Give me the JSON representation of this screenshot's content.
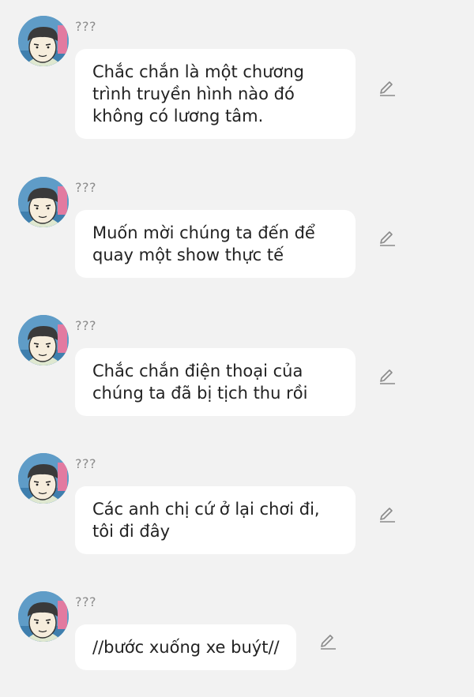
{
  "colors": {
    "background": "#f2f2f2",
    "bubble": "#ffffff",
    "name_text": "#8b8b8b",
    "message_text": "#222222",
    "icon": "#8a8a8a"
  },
  "messages": [
    {
      "sender": "???",
      "text": "Chắc chắn là một chương trình truyền hình nào đó không có lương tâm.",
      "icon": "pencil-edit-icon"
    },
    {
      "sender": "???",
      "text": "Muốn mời chúng ta đến để quay một show thực tế",
      "icon": "pencil-edit-icon"
    },
    {
      "sender": "???",
      "text": "Chắc chắn điện thoại của chúng ta đã bị tịch thu rồi",
      "icon": "pencil-edit-icon"
    },
    {
      "sender": "???",
      "text": "Các anh chị cứ ở lại chơi đi, tôi đi đây",
      "icon": "pencil-edit-icon"
    },
    {
      "sender": "???",
      "text": "//bước xuống xe buýt//",
      "icon": "pencil-edit-icon"
    }
  ]
}
